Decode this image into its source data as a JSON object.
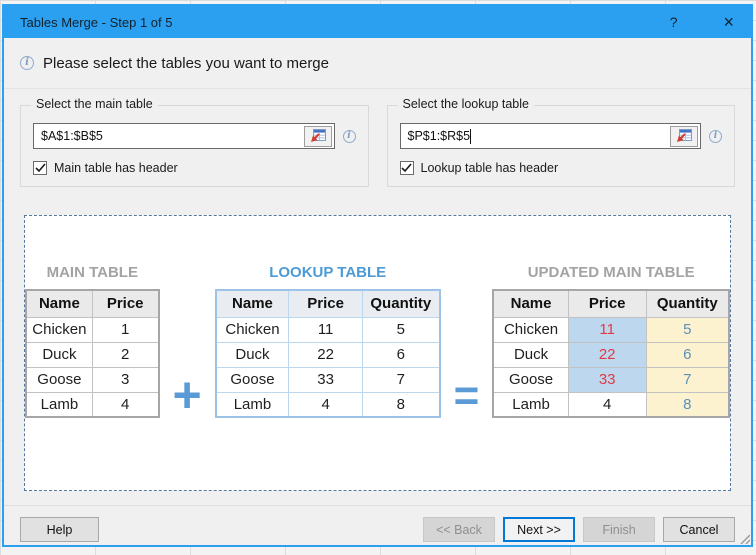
{
  "titlebar": {
    "title": "Tables Merge - Step 1 of 5",
    "help": "?",
    "close": "×"
  },
  "header": {
    "message": "Please select the tables you want to merge"
  },
  "groups": {
    "main": {
      "label": "Select the main table",
      "range": "$A$1:$B$5",
      "checkbox": "Main table has header",
      "checked": true
    },
    "lookup": {
      "label": "Select the lookup table",
      "range": "$P$1:$R$5",
      "checkbox": "Lookup table has header",
      "checked": true
    }
  },
  "preview": {
    "plus": "+",
    "equals": "=",
    "main_table": {
      "title": "MAIN TABLE",
      "headers": [
        "Name",
        "Price"
      ],
      "rows": [
        [
          "Chicken",
          "1"
        ],
        [
          "Duck",
          "2"
        ],
        [
          "Goose",
          "3"
        ],
        [
          "Lamb",
          "4"
        ]
      ]
    },
    "lookup_table": {
      "title": "LOOKUP TABLE",
      "headers": [
        "Name",
        "Price",
        "Quantity"
      ],
      "rows": [
        [
          "Chicken",
          "11",
          "5"
        ],
        [
          "Duck",
          "22",
          "6"
        ],
        [
          "Goose",
          "33",
          "7"
        ],
        [
          "Lamb",
          "4",
          "8"
        ]
      ]
    },
    "updated_table": {
      "title": "UPDATED MAIN TABLE",
      "headers": [
        "Name",
        "Price",
        "Quantity"
      ],
      "rows": [
        [
          "Chicken",
          "11",
          "5"
        ],
        [
          "Duck",
          "22",
          "6"
        ],
        [
          "Goose",
          "33",
          "7"
        ],
        [
          "Lamb",
          "4",
          "8"
        ]
      ],
      "changed_price_rows": [
        0,
        1,
        2
      ]
    }
  },
  "footer": {
    "help": "Help",
    "back": "<< Back",
    "next": "Next >>",
    "finish": "Finish",
    "cancel": "Cancel",
    "back_enabled": false,
    "next_enabled": true,
    "finish_enabled": false,
    "cancel_enabled": true
  },
  "colors": {
    "titlebar": "#2BA0F0",
    "focus_border": "#0078D7",
    "lookup_accent": "#5B9BD5",
    "dashed_border": "#56789E",
    "changed_price_bg": "#BDD7EE",
    "changed_price_text": "#E03A45",
    "quantity_bg": "#FCF2CF",
    "quantity_text": "#5D8FB8"
  }
}
